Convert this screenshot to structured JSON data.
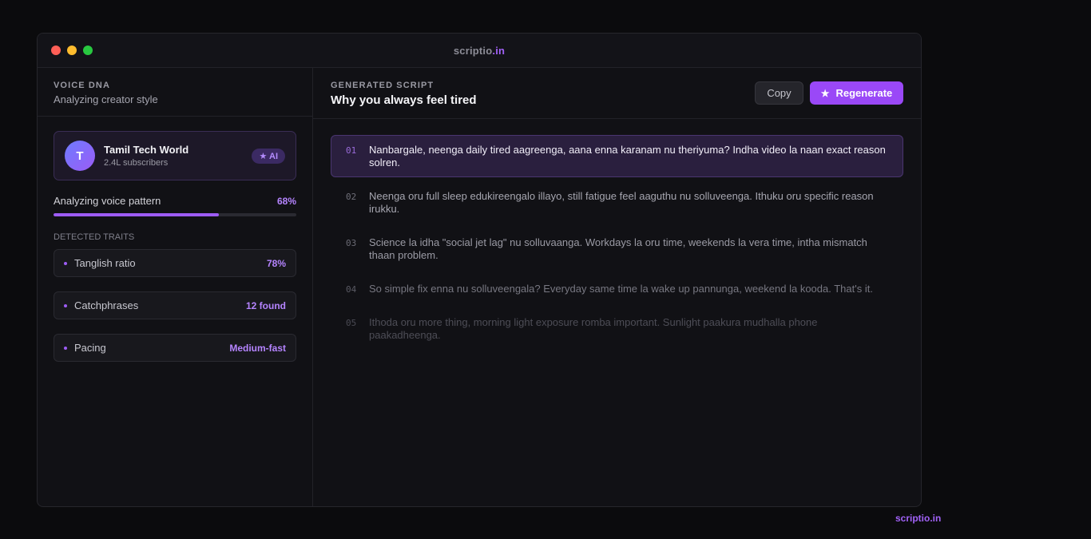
{
  "window": {
    "title_main": "scriptio",
    "title_accent": ".in"
  },
  "sidebar": {
    "eyebrow": "VOICE DNA",
    "subtitle": "Analyzing creator style",
    "profile": {
      "avatar_letter": "T",
      "name": "Tamil Tech World",
      "subscribers": "2.4L subscribers",
      "badge": "★ AI"
    },
    "progress": {
      "label": "Analyzing voice pattern",
      "percent_label": "68%",
      "value": 0.68
    },
    "traits_label": "DETECTED TRAITS",
    "traits": [
      {
        "label": "Tanglish ratio",
        "value": "78%"
      },
      {
        "label": "Catchphrases",
        "value": "12 found"
      },
      {
        "label": "Pacing",
        "value": "Medium-fast"
      }
    ]
  },
  "main": {
    "eyebrow": "GENERATED SCRIPT",
    "title": "Why you always feel tired",
    "copy_label": "Copy",
    "regenerate_label": "Regenerate",
    "regenerate_icon": "★",
    "lines": [
      {
        "num": "01",
        "text": "Nanbargale, neenga daily tired aagreenga, aana enna karanam nu theriyuma? Indha video la naan exact reason solren."
      },
      {
        "num": "02",
        "text": "Neenga oru full sleep edukireengalo illayo, still fatigue feel aaguthu nu solluveenga. Ithuku oru specific reason irukku."
      },
      {
        "num": "03",
        "text": "Science la idha \"social jet lag\" nu solluvaanga. Workdays la oru time, weekends la vera time, intha mismatch thaan problem."
      },
      {
        "num": "04",
        "text": "So simple fix enna nu solluveengala? Everyday same time la wake up pannunga, weekend la kooda. That's it."
      },
      {
        "num": "05",
        "text": "Ithoda oru more thing, morning light exposure romba important. Sunlight paakura mudhalla phone paakadheenga."
      }
    ]
  },
  "footer": {
    "brand_main": "scriptio",
    "brand_accent": ".in"
  },
  "colors": {
    "accent": "#9a48f7",
    "background": "#0b0b0d",
    "traffic_red": "#ff5f57",
    "traffic_yellow": "#febc2e",
    "traffic_green": "#28c840"
  }
}
